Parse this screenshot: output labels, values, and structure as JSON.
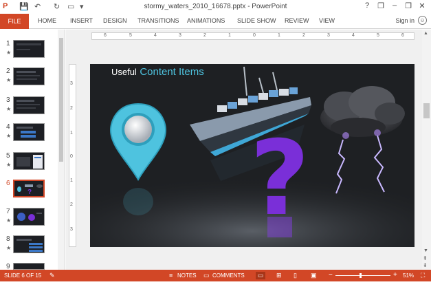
{
  "titlebar": {
    "title": "stormy_waters_2010_16678.pptx - PowerPoint",
    "help": "?",
    "minimize": "–",
    "restore": "❐",
    "close": "✕"
  },
  "ribbon": {
    "file": "FILE",
    "tabs": [
      "HOME",
      "INSERT",
      "DESIGN",
      "TRANSITIONS",
      "ANIMATIONS",
      "SLIDE SHOW",
      "REVIEW",
      "VIEW"
    ],
    "sign_in": "Sign in"
  },
  "slides_panel": {
    "items": [
      {
        "num": "1",
        "star": "★"
      },
      {
        "num": "2",
        "star": "★"
      },
      {
        "num": "3",
        "star": "★"
      },
      {
        "num": "4",
        "star": "★"
      },
      {
        "num": "5",
        "star": "★"
      },
      {
        "num": "6",
        "star": ""
      },
      {
        "num": "7",
        "star": "★"
      },
      {
        "num": "8",
        "star": "★"
      },
      {
        "num": "9",
        "star": ""
      }
    ],
    "active_index": 5
  },
  "ruler": {
    "horizontal": [
      "6",
      "5",
      "4",
      "3",
      "2",
      "1",
      "0",
      "1",
      "2",
      "3",
      "4",
      "5",
      "6"
    ],
    "vertical": [
      "3",
      "2",
      "1",
      "0",
      "1",
      "2",
      "3"
    ]
  },
  "slide": {
    "heading_prefix": "Useful",
    "heading_main": "Content Items"
  },
  "statusbar": {
    "slide_info": "SLIDE 6 OF 15",
    "notes": "NOTES",
    "comments": "COMMENTS",
    "zoom_minus": "−",
    "zoom_plus": "+",
    "zoom": "51%",
    "zoom_fraction": 0.51
  },
  "colors": {
    "accent": "#d24726",
    "slide_bg": "#1e2023",
    "heading_accent": "#4ec3df",
    "question_mark": "#7a2fd8"
  }
}
